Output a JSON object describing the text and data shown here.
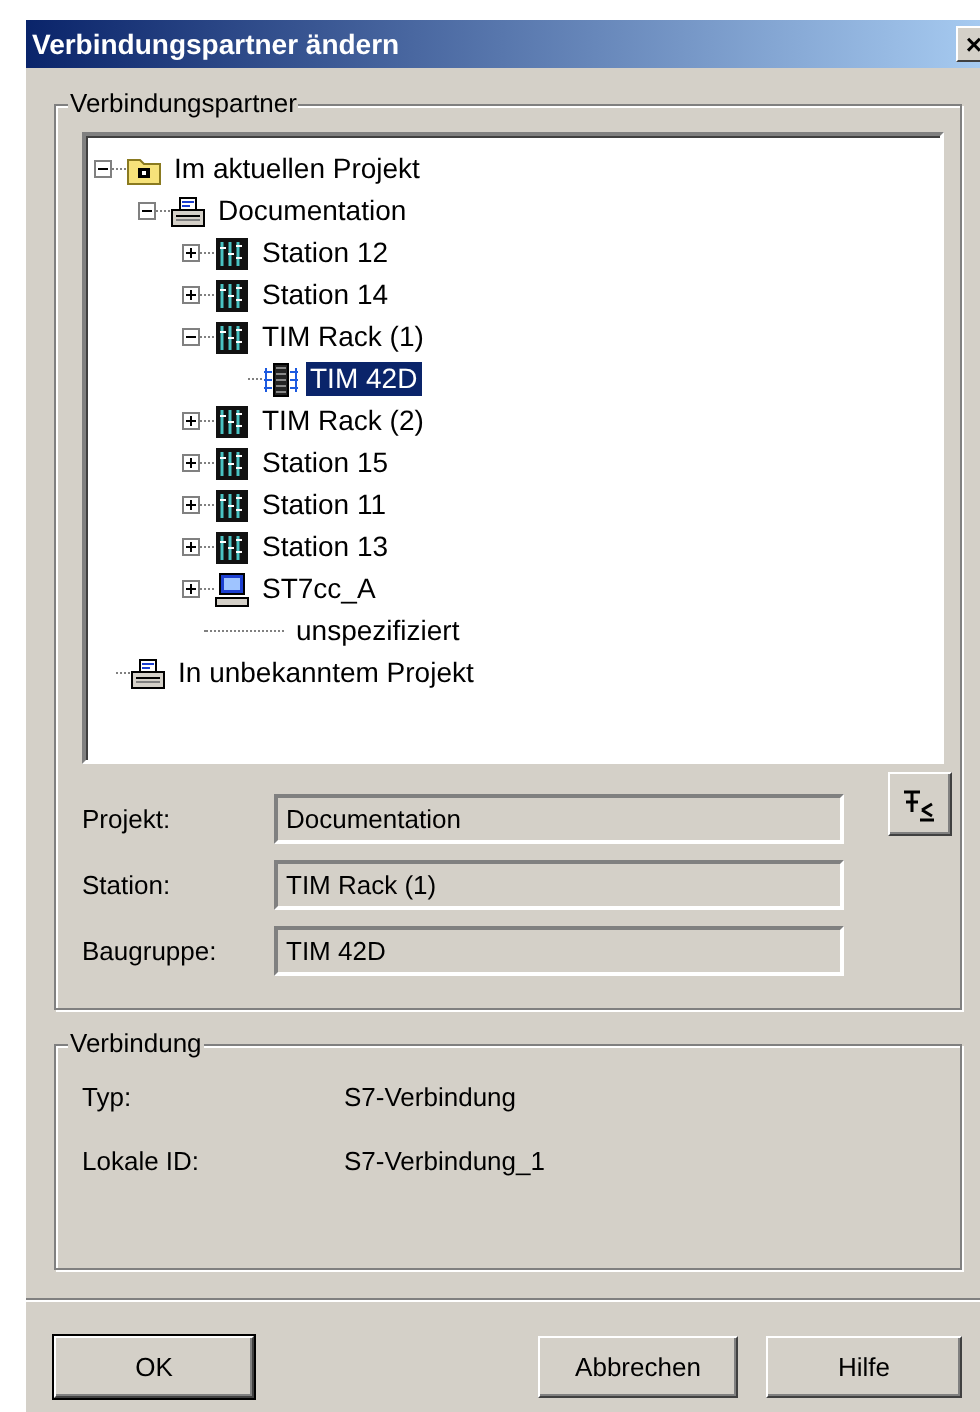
{
  "window": {
    "title": "Verbindungspartner ändern",
    "close": "×"
  },
  "partner_group": {
    "title": "Verbindungspartner",
    "tree": [
      {
        "label": "Im aktuellen Projekt",
        "kind": "folder",
        "expanded": true,
        "selected": false,
        "children": [
          {
            "label": "Documentation",
            "kind": "project",
            "expanded": true,
            "selected": false,
            "children": [
              {
                "label": "Station 12",
                "kind": "station",
                "expanded": false,
                "selected": false
              },
              {
                "label": "Station 14",
                "kind": "station",
                "expanded": false,
                "selected": false
              },
              {
                "label": "TIM Rack (1)",
                "kind": "station",
                "expanded": true,
                "selected": false,
                "children": [
                  {
                    "label": "TIM 42D",
                    "kind": "module",
                    "selected": true
                  }
                ]
              },
              {
                "label": "TIM Rack (2)",
                "kind": "station",
                "expanded": false,
                "selected": false
              },
              {
                "label": "Station 15",
                "kind": "station",
                "expanded": false,
                "selected": false
              },
              {
                "label": "Station 11",
                "kind": "station",
                "expanded": false,
                "selected": false
              },
              {
                "label": "Station 13",
                "kind": "station",
                "expanded": false,
                "selected": false
              },
              {
                "label": "ST7cc_A",
                "kind": "pc",
                "expanded": false,
                "selected": false
              },
              {
                "label": "unspezifiziert",
                "kind": "none",
                "selected": false
              }
            ]
          }
        ]
      },
      {
        "label": "In unbekanntem Projekt",
        "kind": "project",
        "selected": false
      }
    ],
    "fields": [
      {
        "label": "Projekt:",
        "value": "Documentation"
      },
      {
        "label": "Station:",
        "value": "TIM Rack (1)"
      },
      {
        "label": "Baugruppe:",
        "value": "TIM 42D"
      }
    ]
  },
  "connection_group": {
    "title": "Verbindung",
    "rows": [
      {
        "label": "Typ:",
        "value": "S7-Verbindung"
      },
      {
        "label": "Lokale ID:",
        "value": "S7-Verbindung_1"
      }
    ]
  },
  "buttons": [
    {
      "label": "OK",
      "default": true
    },
    {
      "label": "Abbrechen",
      "default": false
    },
    {
      "label": "Hilfe",
      "default": false
    }
  ]
}
